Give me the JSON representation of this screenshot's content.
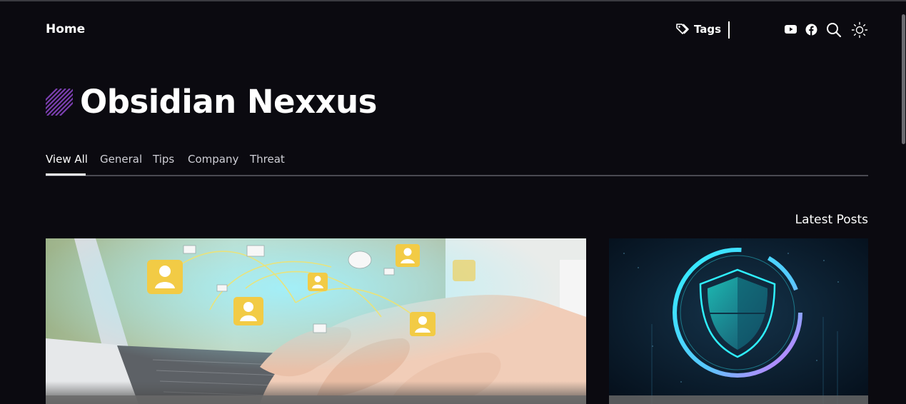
{
  "nav": {
    "home_label": "Home",
    "tags_label": "Tags",
    "icons": [
      "tag-icon",
      "youtube-icon",
      "facebook-icon",
      "search-icon",
      "sun-icon"
    ]
  },
  "site": {
    "title": "Obsidian Nexxus",
    "accent_color": "#7b3fb0"
  },
  "tabs": [
    {
      "label": "View All",
      "active": true
    },
    {
      "label": "General",
      "active": false
    },
    {
      "label": "Tips",
      "active": false
    },
    {
      "label": "Company",
      "active": false
    },
    {
      "label": "Threat",
      "active": false
    }
  ],
  "section": {
    "latest_label": "Latest Posts"
  },
  "posts": [
    {
      "image": "hands typing on laptop with network icons"
    },
    {
      "image": "neon cyber security shield"
    }
  ]
}
